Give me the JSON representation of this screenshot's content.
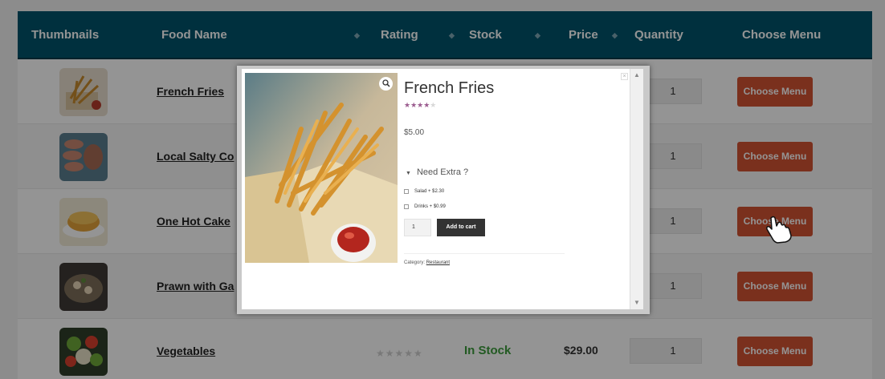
{
  "table": {
    "headers": [
      "Thumbnails",
      "Food Name",
      "Rating",
      "Stock",
      "Price",
      "Quantity",
      "Choose Menu"
    ],
    "rows": [
      {
        "name": "French Fries",
        "qty": "1",
        "button": "Choose Menu"
      },
      {
        "name": "Local Salty Co",
        "qty": "1",
        "button": "Choose Menu"
      },
      {
        "name": "One Hot Cake",
        "qty": "1",
        "button": "Choose Menu"
      },
      {
        "name": "Prawn with Ga",
        "qty": "1",
        "button": "Choose Menu"
      },
      {
        "name": "Vegetables",
        "stars": "★★★★★",
        "stock": "In Stock",
        "price": "$29.00",
        "qty": "1",
        "button": "Choose Menu"
      }
    ]
  },
  "modal": {
    "title": "French Fries",
    "rating_stars_filled": "★★★★",
    "rating_stars_empty": "★",
    "rating_fraction": 0.8,
    "price": "$5.00",
    "extras_title": "Need Extra ?",
    "extras": [
      {
        "label": "Salad + $2.30"
      },
      {
        "label": "Drinks + $0.99"
      }
    ],
    "quantity": "1",
    "add_to_cart": "Add to cart",
    "category_label": "Category:",
    "category_link": "Restaurant"
  },
  "colors": {
    "header_bg": "#00546b",
    "button_bg": "#d35433",
    "stock_green": "#3b9b3b",
    "star_purple": "#9b5c8f"
  },
  "icons": [
    "zoom-icon",
    "close-icon",
    "hand-cursor-icon",
    "scroll-up-icon",
    "scroll-down-icon",
    "triangle-icon",
    "sort-icon"
  ]
}
